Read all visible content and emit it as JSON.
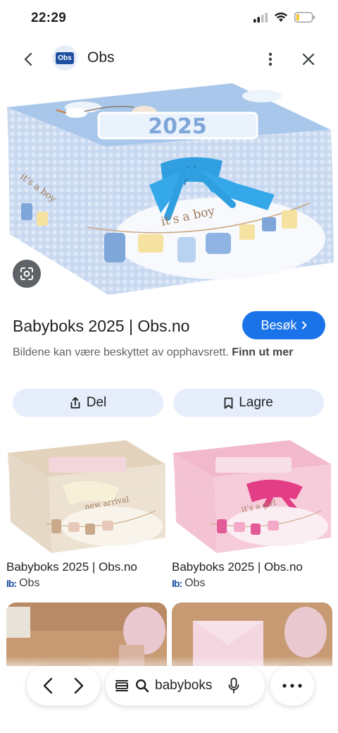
{
  "status": {
    "time": "22:29"
  },
  "header": {
    "site_name": "Obs",
    "logo_text": "Obs"
  },
  "result": {
    "title": "Babyboks 2025 | Obs.no",
    "visit_label": "Besøk",
    "copyright_text": "Bildene kan være beskyttet av opphavsrett.",
    "learn_more": "Finn ut mer",
    "share_label": "Del",
    "save_label": "Lagre"
  },
  "hero_image": {
    "year_text": "2025",
    "caption_text": "it's a boy"
  },
  "related": [
    {
      "title": "Babyboks 2025 | Obs.no",
      "source": "Obs",
      "caption_text": "new arrival",
      "color": "#e9dccb"
    },
    {
      "title": "Babyboks 2025 | Obs.no",
      "source": "Obs",
      "caption_text": "it's a girl",
      "color": "#f3c9d9"
    }
  ],
  "search": {
    "query": "babyboks"
  },
  "colors": {
    "accent": "#1a73e8",
    "chip_bg": "#e6eefc",
    "brand": "#1f4fa1"
  }
}
